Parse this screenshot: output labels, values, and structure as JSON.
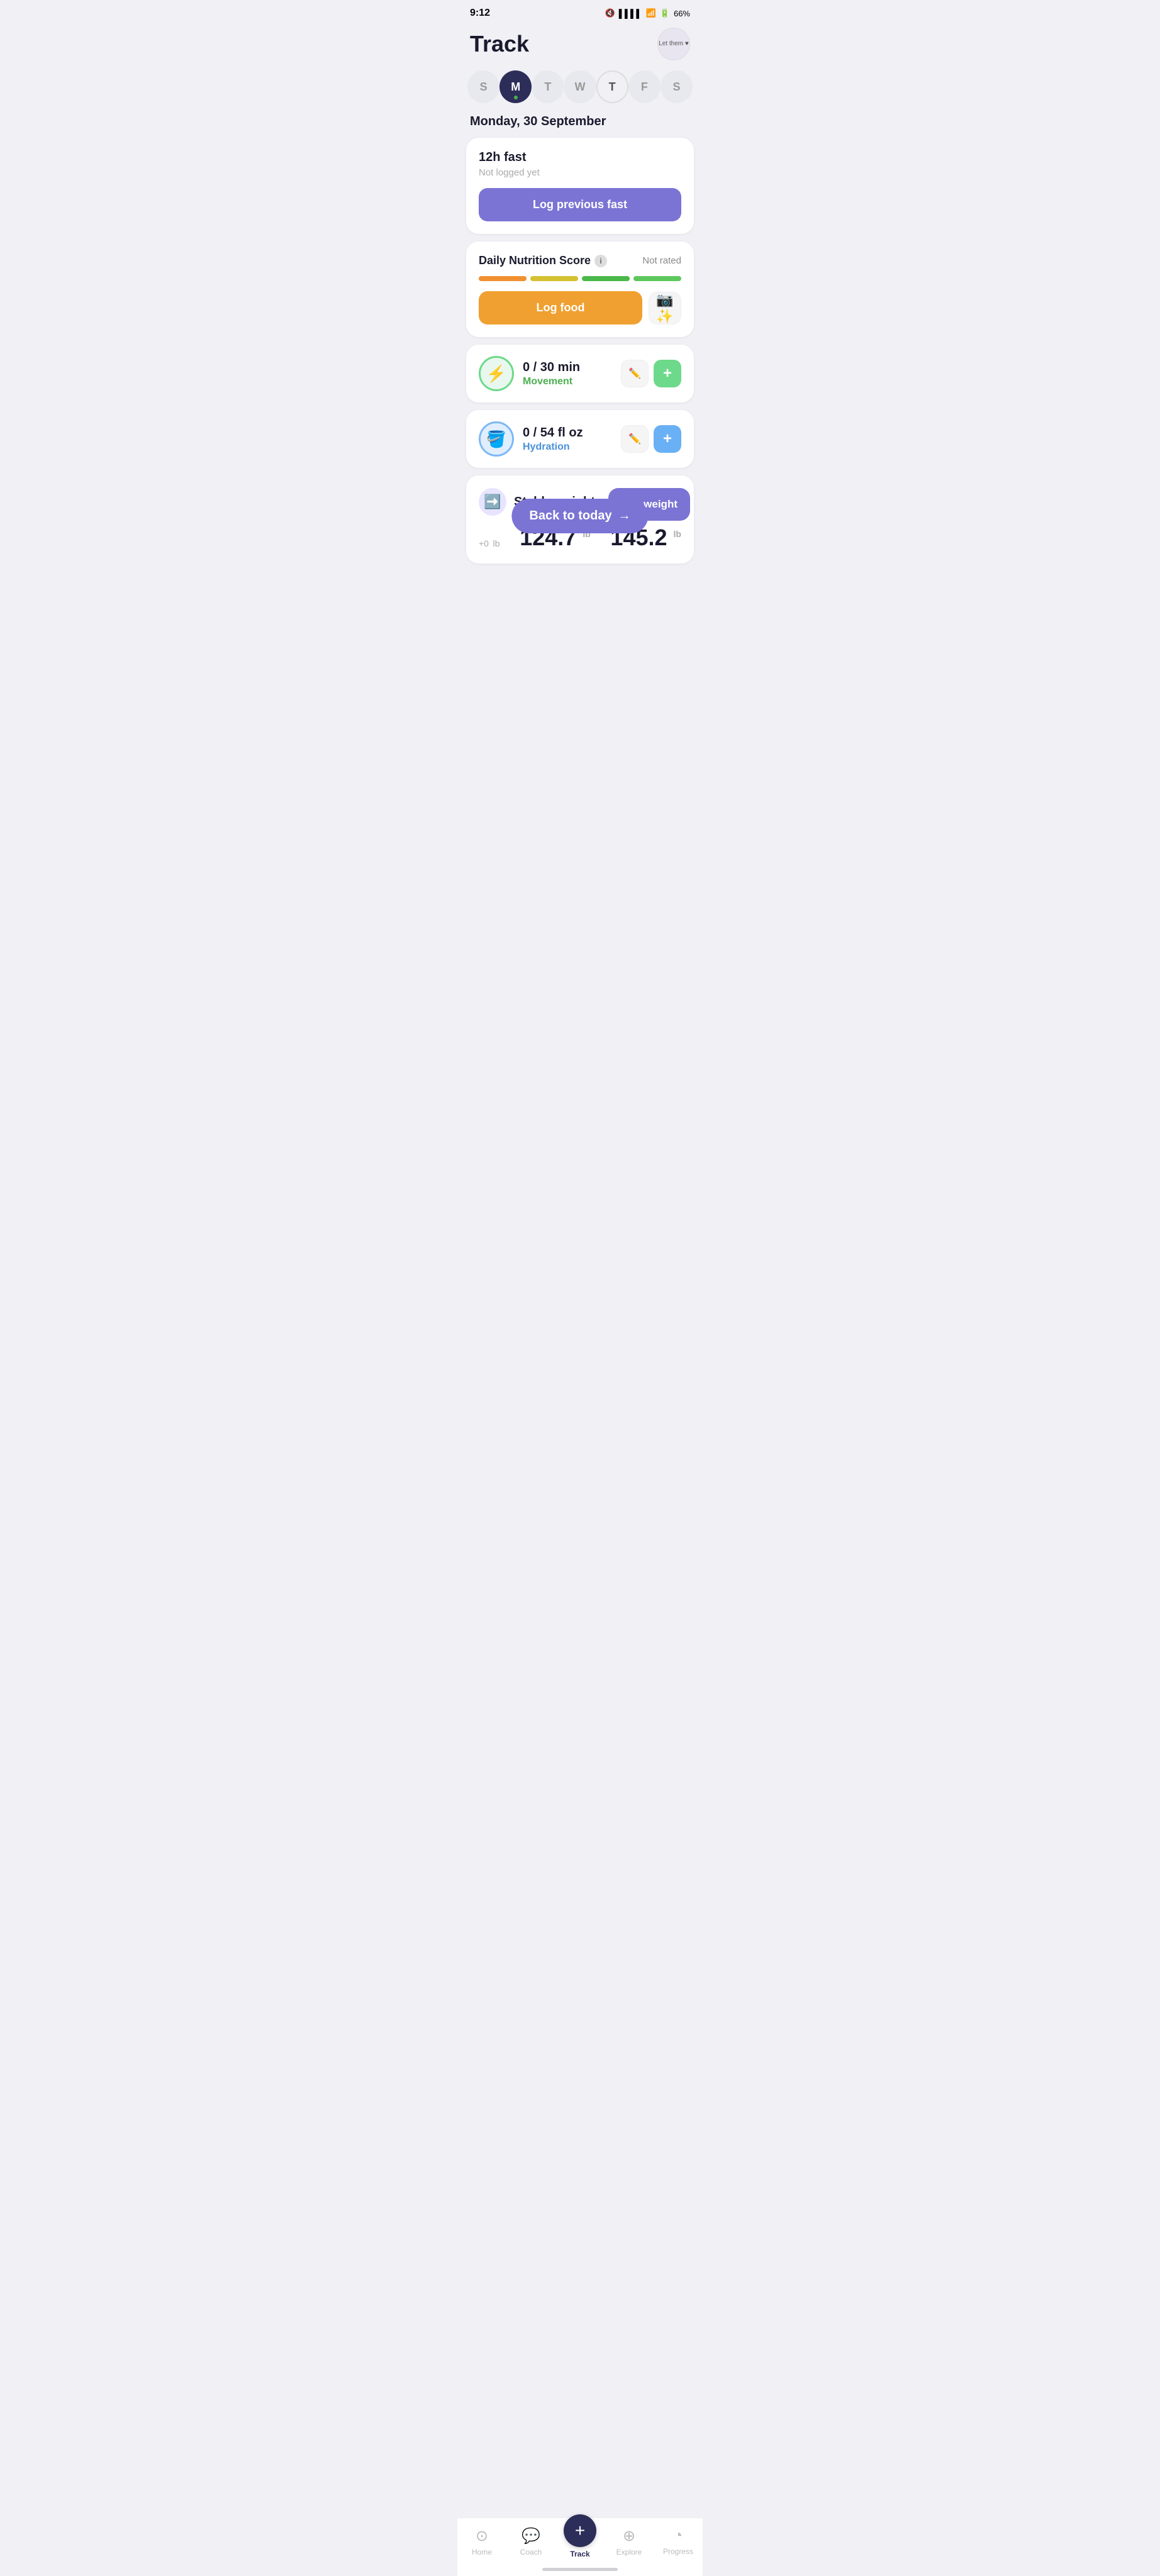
{
  "statusBar": {
    "time": "9:12",
    "battery": "66%"
  },
  "header": {
    "title": "Track",
    "avatarText": "Let them\n♥"
  },
  "days": [
    {
      "label": "S",
      "active": false,
      "todayRing": false,
      "dot": false
    },
    {
      "label": "M",
      "active": true,
      "todayRing": false,
      "dot": true
    },
    {
      "label": "T",
      "active": false,
      "todayRing": false,
      "dot": false
    },
    {
      "label": "W",
      "active": false,
      "todayRing": false,
      "dot": false
    },
    {
      "label": "T",
      "active": false,
      "todayRing": true,
      "dot": false
    },
    {
      "label": "F",
      "active": false,
      "todayRing": false,
      "dot": false
    },
    {
      "label": "S",
      "active": false,
      "todayRing": false,
      "dot": false
    }
  ],
  "dateLabel": "Monday, 30 September",
  "fastCard": {
    "title": "12h fast",
    "subtitle": "Not logged yet",
    "buttonLabel": "Log previous fast"
  },
  "nutritionCard": {
    "title": "Daily Nutrition Score",
    "status": "Not rated",
    "bars": [
      {
        "color": "#f09030",
        "width": "22%"
      },
      {
        "color": "#d4c030",
        "width": "22%"
      },
      {
        "color": "#4ab84a",
        "width": "28%"
      },
      {
        "color": "#5cc85c",
        "width": "28%"
      }
    ],
    "logFoodLabel": "Log food",
    "scanLabel": "📷"
  },
  "movementCard": {
    "value": "0 / 30 min",
    "label": "Movement",
    "icon": "⚡"
  },
  "hydrationCard": {
    "value": "0 / 54 fl oz",
    "label": "Hydration",
    "icon": "🪣"
  },
  "weightCard": {
    "title": "Stable weight",
    "icon": "➡️",
    "change": "+0",
    "changeUnit": "lb",
    "currentWeight": "124.7",
    "currentUnit": "lb",
    "maxWeight": "145.2",
    "maxUnit": "lb"
  },
  "floatingButtons": {
    "backToToday": "Back to today",
    "logWeight": "Log weight"
  },
  "bottomNav": {
    "items": [
      {
        "label": "Home",
        "icon": "⊙",
        "active": false
      },
      {
        "label": "Coach",
        "icon": "💬",
        "active": false
      },
      {
        "label": "Track",
        "icon": "+",
        "active": true
      },
      {
        "label": "Explore",
        "icon": "⊕",
        "active": false
      },
      {
        "label": "Progress",
        "icon": "◔",
        "active": false
      }
    ]
  }
}
